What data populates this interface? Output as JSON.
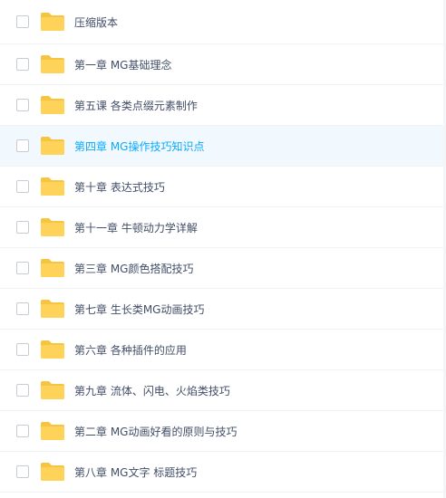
{
  "colors": {
    "folder": "#ffd25a",
    "folder_back": "#f7c43f",
    "text": "#424e67",
    "selected_text": "#09aaff",
    "selected_row": "#f2f9fe",
    "divider": "#f1f2f4"
  },
  "icons": {
    "checkbox": "empty-checkbox",
    "item": "folder-icon"
  },
  "files": [
    {
      "name": "压缩版本",
      "selected": false
    },
    {
      "name": "第一章 MG基础理念",
      "selected": false
    },
    {
      "name": "第五课 各类点缀元素制作",
      "selected": false
    },
    {
      "name": "第四章 MG操作技巧知识点",
      "selected": true
    },
    {
      "name": "第十章 表达式技巧",
      "selected": false
    },
    {
      "name": "第十一章 牛顿动力学详解",
      "selected": false
    },
    {
      "name": "第三章 MG颜色搭配技巧",
      "selected": false
    },
    {
      "name": "第七章 生长类MG动画技巧",
      "selected": false
    },
    {
      "name": "第六章 各种插件的应用",
      "selected": false
    },
    {
      "name": "第九章 流体、闪电、火焰类技巧",
      "selected": false
    },
    {
      "name": "第二章 MG动画好看的原则与技巧",
      "selected": false
    },
    {
      "name": "第八章 MG文字 标题技巧",
      "selected": false
    }
  ]
}
